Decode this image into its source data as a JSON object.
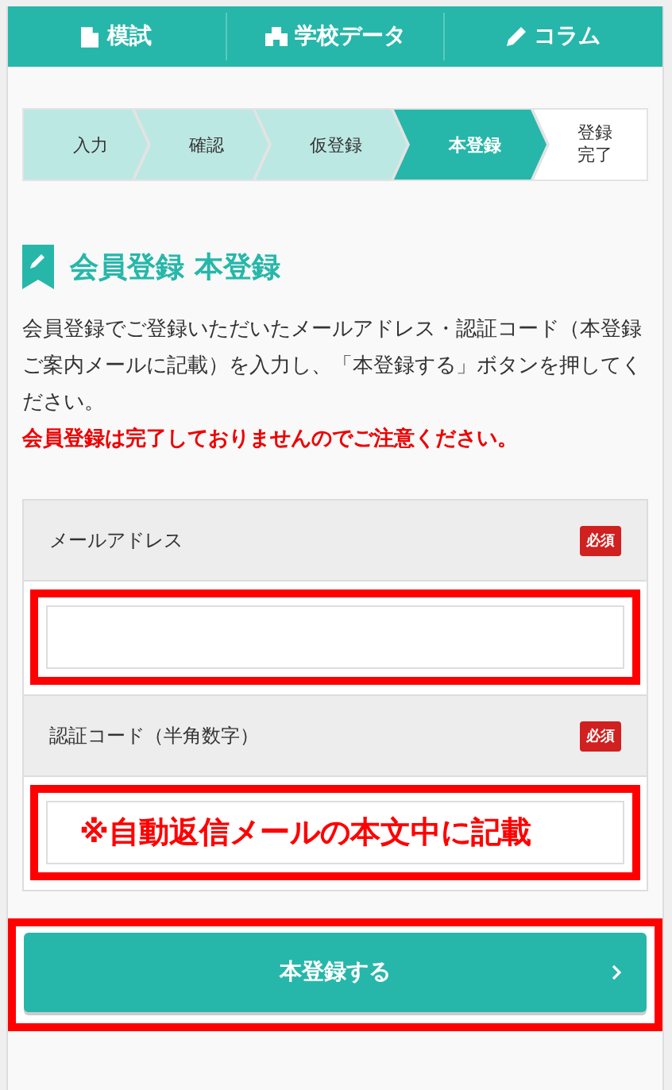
{
  "nav": [
    {
      "label": "模試"
    },
    {
      "label": "学校データ"
    },
    {
      "label": "コラム"
    }
  ],
  "steps": [
    {
      "label": "入力",
      "selected": false
    },
    {
      "label": "確認",
      "selected": false
    },
    {
      "label": "仮登録",
      "selected": false
    },
    {
      "label": "本登録",
      "selected": true
    },
    {
      "label": "登録完了",
      "selected": false
    }
  ],
  "heading": "会員登録 本登録",
  "intro": "会員登録でご登録いただいたメールアドレス・認証コード（本登録ご案内メールに記載）を入力し、「本登録する」ボタンを押してください。",
  "warning": "会員登録は完了しておりませんのでご注意ください。",
  "fields": [
    {
      "label": "メールアドレス",
      "badge": "必須",
      "highlighted": true
    },
    {
      "label": "認証コード（半角数字）",
      "badge": "必須",
      "highlighted": true,
      "annotation": "※自動返信メールの本文中に記載"
    }
  ],
  "submit": {
    "label": "本登録する",
    "highlighted": true
  }
}
